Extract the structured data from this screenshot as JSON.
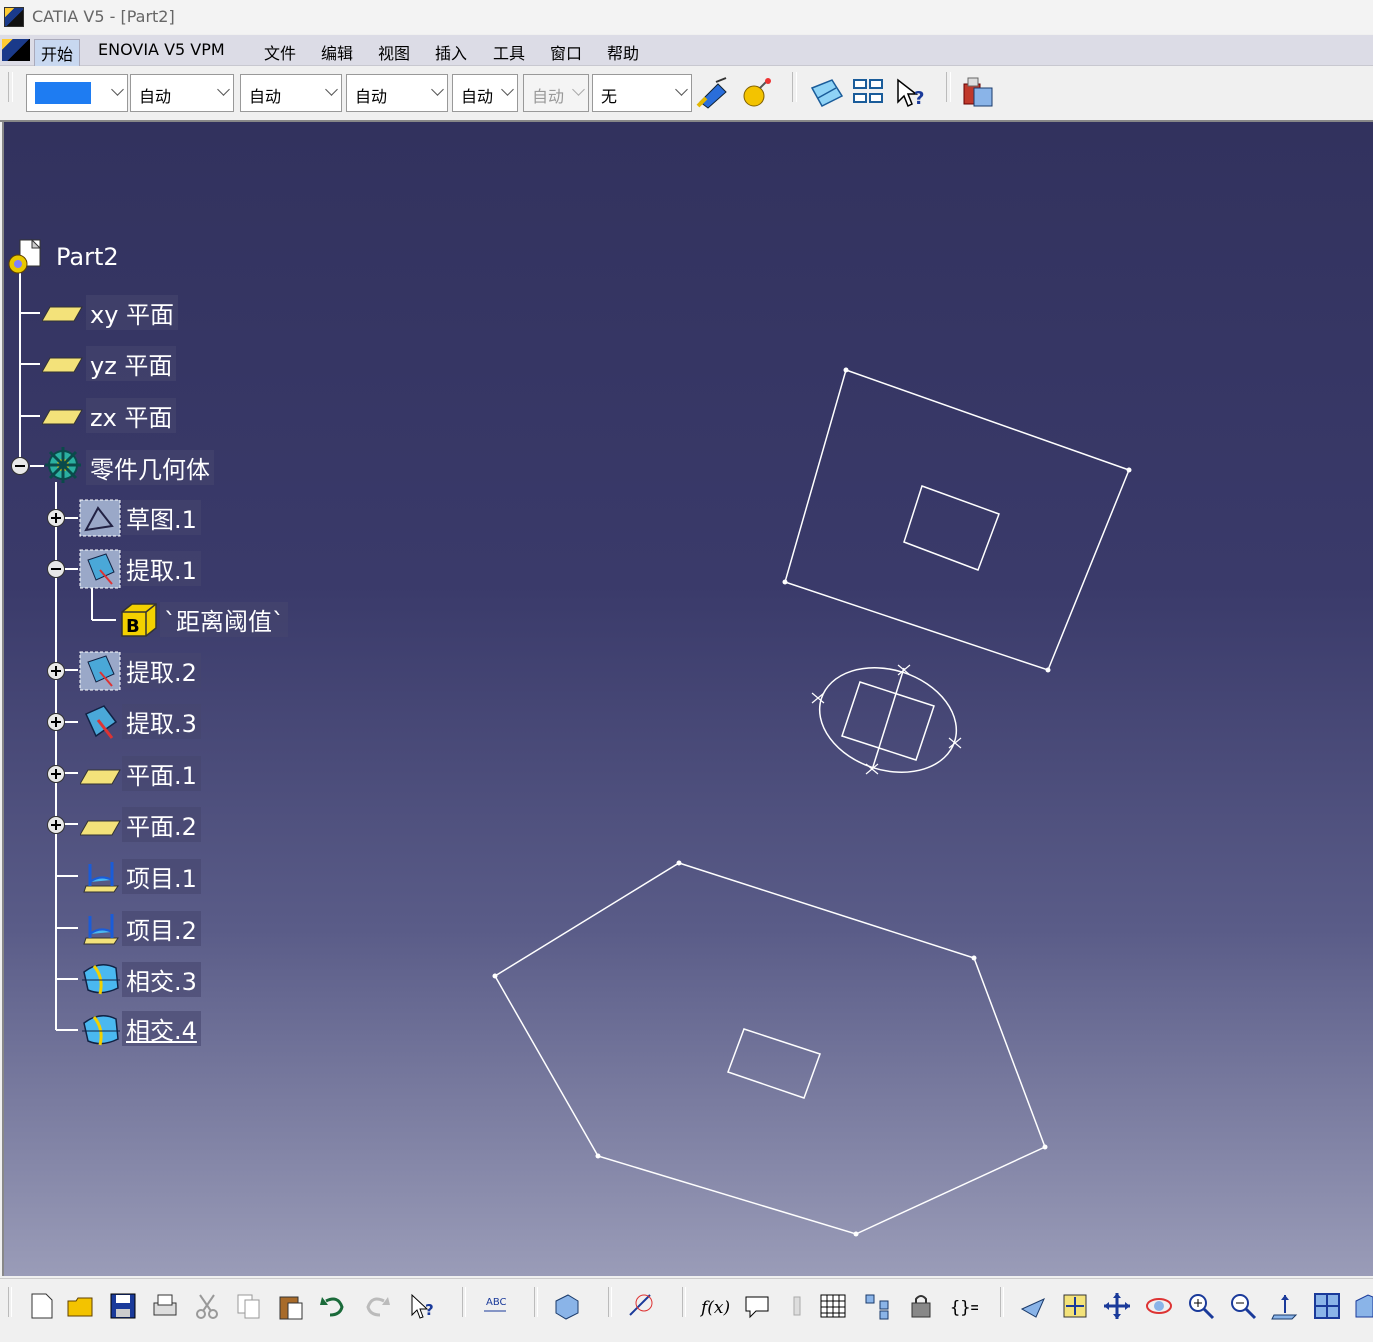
{
  "window": {
    "title": "CATIA V5 - [Part2]"
  },
  "menu": {
    "items": [
      "开始",
      "ENOVIA V5 VPM",
      "文件",
      "编辑",
      "视图",
      "插入",
      "工具",
      "窗口",
      "帮助"
    ]
  },
  "toolbar": {
    "color_value": "#1e7cf2",
    "combo1": "自动",
    "combo2": "自动",
    "combo3": "自动",
    "combo4": "自动",
    "combo5": "自动",
    "combo6": "无"
  },
  "tree": {
    "root": "Part2",
    "planes": [
      "xy 平面",
      "yz 平面",
      "zx 平面"
    ],
    "body": "零件几何体",
    "children": [
      {
        "label": "草图.1",
        "expand": "plus"
      },
      {
        "label": "提取.1",
        "expand": "minus"
      },
      {
        "label": "`距离阈值`",
        "expand": "none"
      },
      {
        "label": "提取.2",
        "expand": "plus"
      },
      {
        "label": "提取.3",
        "expand": "plus"
      },
      {
        "label": "平面.1",
        "expand": "plus"
      },
      {
        "label": "平面.2",
        "expand": "plus"
      },
      {
        "label": "项目.1",
        "expand": "none"
      },
      {
        "label": "项目.2",
        "expand": "none"
      },
      {
        "label": "相交.3",
        "expand": "none"
      },
      {
        "label": "相交.4",
        "expand": "none"
      }
    ]
  },
  "colors": {
    "viewport_top": "#32325e",
    "viewport_bottom": "#9a9cb8",
    "geometry_stroke": "#ffffff",
    "tree_line": "#ffffff"
  }
}
